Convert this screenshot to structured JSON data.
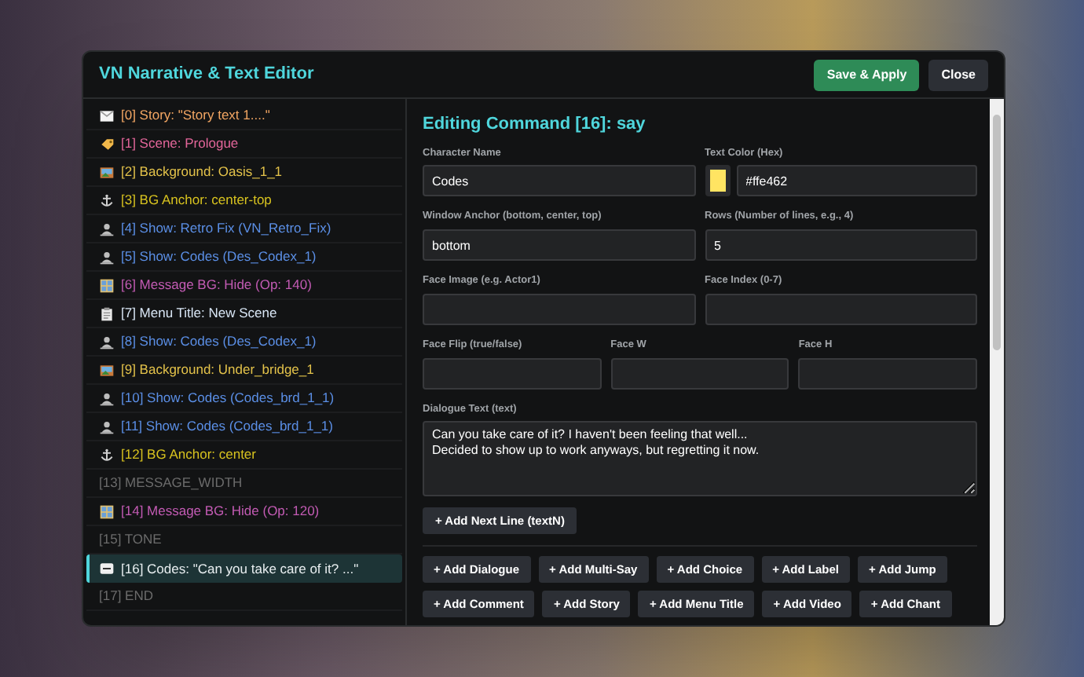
{
  "window": {
    "title": "VN Narrative & Text Editor"
  },
  "header_buttons": [
    {
      "label": "Save & Apply",
      "kind": "primary"
    },
    {
      "label": "Close",
      "kind": "secondary"
    }
  ],
  "commands": [
    {
      "label": "[0] Story: \"Story text 1....\"",
      "kind": "story",
      "color": "#f2a663",
      "selected": false
    },
    {
      "label": "[1] Scene: Prologue",
      "kind": "scene",
      "color": "#e3669a",
      "selected": false
    },
    {
      "label": "[2] Background: Oasis_1_1",
      "kind": "background",
      "color": "#e3c24a",
      "selected": false
    },
    {
      "label": "[3] BG Anchor: center-top",
      "kind": "anchor",
      "color": "#d7c21f",
      "selected": false
    },
    {
      "label": "[4] Show: Retro Fix (VN_Retro_Fix)",
      "kind": "show",
      "color": "#5b8fe6",
      "selected": false
    },
    {
      "label": "[5] Show: Codes (Des_Codex_1)",
      "kind": "show",
      "color": "#5b8fe6",
      "selected": false
    },
    {
      "label": "[6] Message BG: Hide (Op: 140)",
      "kind": "message_bg",
      "color": "#c35bb4",
      "selected": false
    },
    {
      "label": "[7] Menu Title: New Scene",
      "kind": "menu_title",
      "color": "#d9e6f5",
      "selected": false
    },
    {
      "label": "[8] Show: Codes (Des_Codex_1)",
      "kind": "show",
      "color": "#5b8fe6",
      "selected": false
    },
    {
      "label": "[9] Background: Under_bridge_1",
      "kind": "background",
      "color": "#e3c24a",
      "selected": false
    },
    {
      "label": "[10] Show: Codes (Codes_brd_1_1)",
      "kind": "show",
      "color": "#5b8fe6",
      "selected": false
    },
    {
      "label": "[11] Show: Codes (Codes_brd_1_1)",
      "kind": "show",
      "color": "#5b8fe6",
      "selected": false
    },
    {
      "label": "[12] BG Anchor: center",
      "kind": "anchor",
      "color": "#d7c21f",
      "selected": false
    },
    {
      "label": "[13] MESSAGE_WIDTH",
      "kind": "plain",
      "color": "#6b6b6b",
      "selected": false
    },
    {
      "label": "[14] Message BG: Hide (Op: 120)",
      "kind": "message_bg",
      "color": "#c35bb4",
      "selected": false
    },
    {
      "label": "[15] TONE",
      "kind": "plain",
      "color": "#6b6b6b",
      "selected": false
    },
    {
      "label": "[16] Codes: \"Can you take care of it? ...\"",
      "kind": "say",
      "color": "#e8eef0",
      "selected": true
    },
    {
      "label": "[17] END",
      "kind": "plain",
      "color": "#6b6b6b",
      "selected": false
    }
  ],
  "editor": {
    "heading": "Editing Command [16]: say",
    "rows": [
      [
        {
          "label": "Character Name",
          "value": "Codes",
          "kind": "text"
        },
        {
          "label": "Text Color (Hex)",
          "value": "#ffe462",
          "kind": "color",
          "color": "#ffe462"
        }
      ],
      [
        {
          "label": "Window Anchor (bottom, center, top)",
          "value": "bottom",
          "kind": "text"
        },
        {
          "label": "Rows (Number of lines, e.g., 4)",
          "value": "5",
          "kind": "text"
        }
      ],
      [
        {
          "label": "Face Image (e.g. Actor1)",
          "kind": "text"
        },
        {
          "label": "Face Index (0-7)",
          "kind": "text"
        }
      ],
      [
        {
          "label": "Face Flip (true/false)",
          "kind": "text"
        },
        {
          "label": "Face W",
          "kind": "text"
        },
        {
          "label": "Face H",
          "kind": "text"
        }
      ]
    ],
    "dialogue": {
      "label": "Dialogue Text (text)",
      "value": "Can you take care of it? I haven't been feeling that well...\nDecided to show up to work anyways, but regretting it now."
    },
    "next_line_button": "+ Add Next Line (textN)",
    "add_buttons": [
      [
        "+ Add Dialogue",
        "+ Add Multi-Say",
        "+ Add Choice",
        "+ Add Label",
        "+ Add Jump"
      ],
      [
        "+ Add Comment",
        "+ Add Story",
        "+ Add Menu Title",
        "+ Add Video",
        "+ Add Chant"
      ]
    ]
  }
}
